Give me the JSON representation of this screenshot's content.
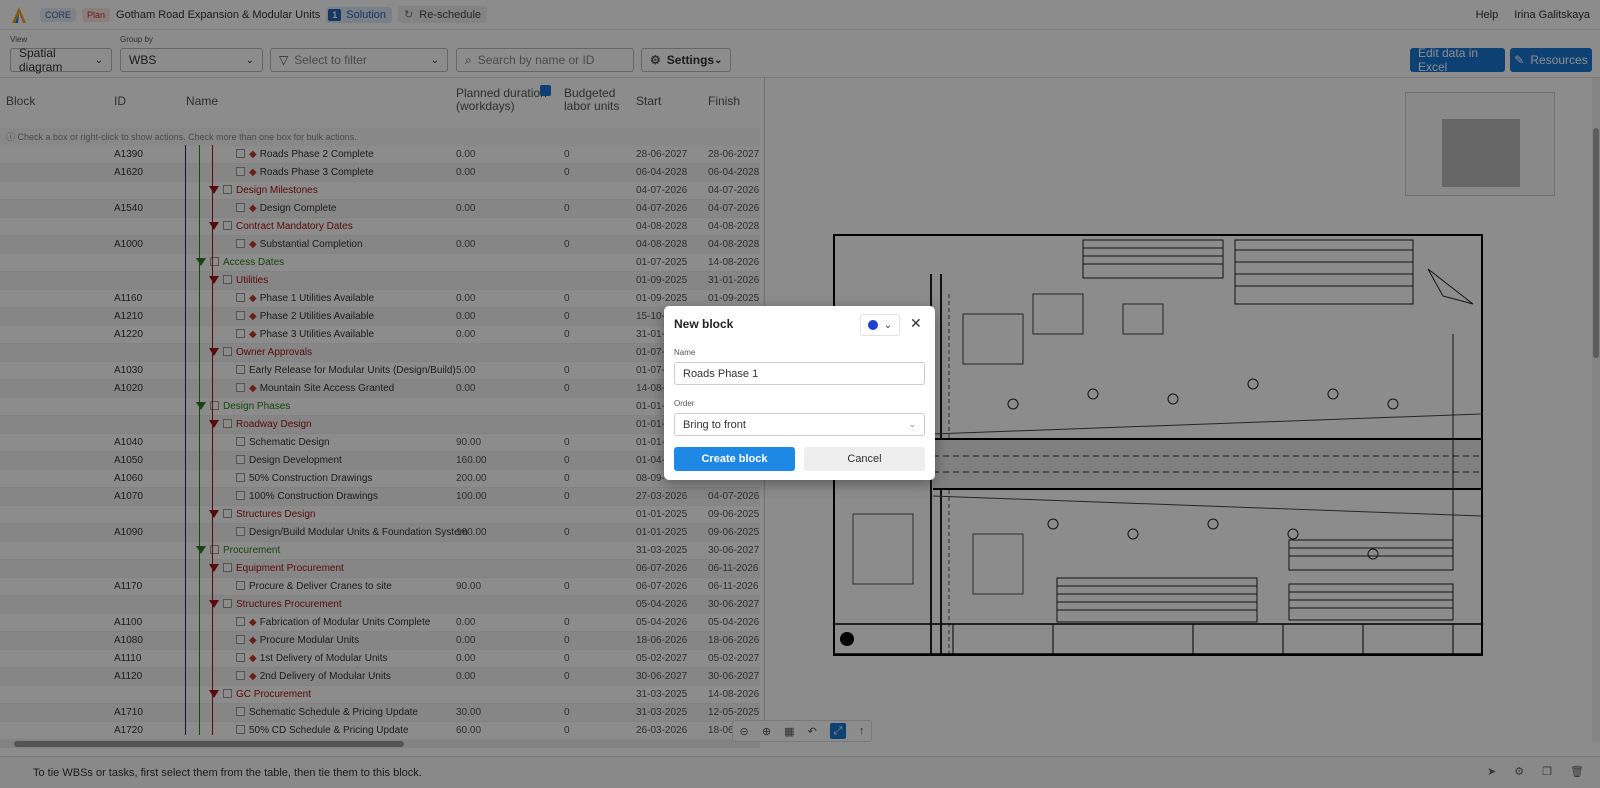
{
  "topbar": {
    "badge_core": "CORE",
    "badge_plan": "Plan",
    "project_title": "Gotham Road Expansion & Modular Units",
    "solution_number": "1",
    "solution_label": "Solution",
    "reschedule_label": "Re-schedule",
    "help_label": "Help",
    "user_name": "Irina Galitskaya"
  },
  "toolbar": {
    "view_label": "View",
    "view_value": "Spatial diagram",
    "group_by_label": "Group by",
    "group_by_value": "WBS",
    "filter_placeholder": "Select to filter",
    "search_placeholder": "Search by name or ID",
    "settings_label": "Settings",
    "edit_excel_label": "Edit data in Excel",
    "resources_label": "Resources"
  },
  "table": {
    "columns": {
      "block": "Block",
      "id": "ID",
      "name": "Name",
      "duration": "Planned duration (workdays)",
      "budget": "Budgeted labor units",
      "start": "Start",
      "finish": "Finish"
    },
    "hint": "Check a box or right-click to show actions. Check more than one box for bulk actions.",
    "rows": [
      {
        "id": "A1390",
        "name": "Roads Phase 2 Complete",
        "type": "milestone",
        "duration": "0.00",
        "budget": "0",
        "start": "28-06-2027",
        "finish": "28-06-2027"
      },
      {
        "id": "A1620",
        "name": "Roads Phase 3 Complete",
        "type": "milestone",
        "duration": "0.00",
        "budget": "0",
        "start": "06-04-2028",
        "finish": "06-04-2028"
      },
      {
        "id": "",
        "name": "Design Milestones",
        "type": "wbs2",
        "duration": "",
        "budget": "",
        "start": "04-07-2026",
        "finish": "04-07-2026"
      },
      {
        "id": "A1540",
        "name": "Design Complete",
        "type": "milestone",
        "duration": "0.00",
        "budget": "0",
        "start": "04-07-2026",
        "finish": "04-07-2026"
      },
      {
        "id": "",
        "name": "Contract Mandatory Dates",
        "type": "wbs2",
        "duration": "",
        "budget": "",
        "start": "04-08-2028",
        "finish": "04-08-2028"
      },
      {
        "id": "A1000",
        "name": "Substantial Completion",
        "type": "milestone",
        "duration": "0.00",
        "budget": "0",
        "start": "04-08-2028",
        "finish": "04-08-2028"
      },
      {
        "id": "",
        "name": "Access Dates",
        "type": "wbs1",
        "duration": "",
        "budget": "",
        "start": "01-07-2025",
        "finish": "14-08-2026"
      },
      {
        "id": "",
        "name": "Utilities",
        "type": "wbs2",
        "duration": "",
        "budget": "",
        "start": "01-09-2025",
        "finish": "31-01-2026"
      },
      {
        "id": "A1160",
        "name": "Phase 1 Utilities Available",
        "type": "milestone",
        "duration": "0.00",
        "budget": "0",
        "start": "01-09-2025",
        "finish": "01-09-2025"
      },
      {
        "id": "A1210",
        "name": "Phase 2 Utilities Available",
        "type": "milestone",
        "duration": "0.00",
        "budget": "0",
        "start": "15-10-",
        "finish": ""
      },
      {
        "id": "A1220",
        "name": "Phase 3 Utilities Available",
        "type": "milestone",
        "duration": "0.00",
        "budget": "0",
        "start": "31-01-",
        "finish": ""
      },
      {
        "id": "",
        "name": "Owner Approvals",
        "type": "wbs2",
        "duration": "",
        "budget": "",
        "start": "01-07-",
        "finish": ""
      },
      {
        "id": "A1030",
        "name": "Early Release for Modular Units (Design/Build)",
        "type": "task",
        "duration": "5.00",
        "budget": "0",
        "start": "01-07-",
        "finish": ""
      },
      {
        "id": "A1020",
        "name": "Mountain Site Access Granted",
        "type": "milestone",
        "duration": "0.00",
        "budget": "0",
        "start": "14-08-",
        "finish": ""
      },
      {
        "id": "",
        "name": "Design Phases",
        "type": "wbs1",
        "duration": "",
        "budget": "",
        "start": "01-01-",
        "finish": ""
      },
      {
        "id": "",
        "name": "Roadway Design",
        "type": "wbs2",
        "duration": "",
        "budget": "",
        "start": "01-01-",
        "finish": ""
      },
      {
        "id": "A1040",
        "name": "Schematic Design",
        "type": "task",
        "duration": "90.00",
        "budget": "0",
        "start": "01-01-",
        "finish": ""
      },
      {
        "id": "A1050",
        "name": "Design Development",
        "type": "task",
        "duration": "160.00",
        "budget": "0",
        "start": "01-04-",
        "finish": ""
      },
      {
        "id": "A1060",
        "name": "50% Construction Drawings",
        "type": "task",
        "duration": "200.00",
        "budget": "0",
        "start": "08-09-",
        "finish": ""
      },
      {
        "id": "A1070",
        "name": "100% Construction Drawings",
        "type": "task",
        "duration": "100.00",
        "budget": "0",
        "start": "27-03-2026",
        "finish": "04-07-2026"
      },
      {
        "id": "",
        "name": "Structures Design",
        "type": "wbs2",
        "duration": "",
        "budget": "",
        "start": "01-01-2025",
        "finish": "09-06-2025"
      },
      {
        "id": "A1090",
        "name": "Design/Build Modular Units & Foundation System",
        "type": "task",
        "duration": "160.00",
        "budget": "0",
        "start": "01-01-2025",
        "finish": "09-06-2025"
      },
      {
        "id": "",
        "name": "Procurement",
        "type": "wbs1",
        "duration": "",
        "budget": "",
        "start": "31-03-2025",
        "finish": "30-06-2027"
      },
      {
        "id": "",
        "name": "Equipment Procurement",
        "type": "wbs2",
        "duration": "",
        "budget": "",
        "start": "06-07-2026",
        "finish": "06-11-2026"
      },
      {
        "id": "A1170",
        "name": "Procure & Deliver Cranes to site",
        "type": "task",
        "duration": "90.00",
        "budget": "0",
        "start": "06-07-2026",
        "finish": "06-11-2026"
      },
      {
        "id": "",
        "name": "Structures Procurement",
        "type": "wbs2",
        "duration": "",
        "budget": "",
        "start": "05-04-2026",
        "finish": "30-06-2027"
      },
      {
        "id": "A1100",
        "name": "Fabrication of Modular Units Complete",
        "type": "milestone",
        "duration": "0.00",
        "budget": "0",
        "start": "05-04-2026",
        "finish": "05-04-2026"
      },
      {
        "id": "A1080",
        "name": "Procure Modular Units",
        "type": "milestone",
        "duration": "0.00",
        "budget": "0",
        "start": "18-06-2026",
        "finish": "18-06-2026"
      },
      {
        "id": "A1110",
        "name": "1st Delivery of Modular Units",
        "type": "milestone",
        "duration": "0.00",
        "budget": "0",
        "start": "05-02-2027",
        "finish": "05-02-2027"
      },
      {
        "id": "A1120",
        "name": "2nd Delivery of Modular Units",
        "type": "milestone",
        "duration": "0.00",
        "budget": "0",
        "start": "30-06-2027",
        "finish": "30-06-2027"
      },
      {
        "id": "",
        "name": "GC Procurement",
        "type": "wbs2",
        "duration": "",
        "budget": "",
        "start": "31-03-2025",
        "finish": "14-08-2026"
      },
      {
        "id": "A1710",
        "name": "Schematic Schedule & Pricing Update",
        "type": "task",
        "duration": "30.00",
        "budget": "0",
        "start": "31-03-2025",
        "finish": "12-05-2025"
      },
      {
        "id": "A1720",
        "name": "50% CD Schedule & Pricing Update",
        "type": "task",
        "duration": "60.00",
        "budget": "0",
        "start": "26-03-2026",
        "finish": "18-06-"
      }
    ]
  },
  "footer": {
    "message": "To tie WBSs or tasks, first select them from the table, then tie them to this block."
  },
  "modal": {
    "title": "New block",
    "color": "#1f3fcf",
    "name_label": "Name",
    "name_value": "Roads Phase 1",
    "order_label": "Order",
    "order_value": "Bring to front",
    "create_label": "Create block",
    "cancel_label": "Cancel"
  }
}
